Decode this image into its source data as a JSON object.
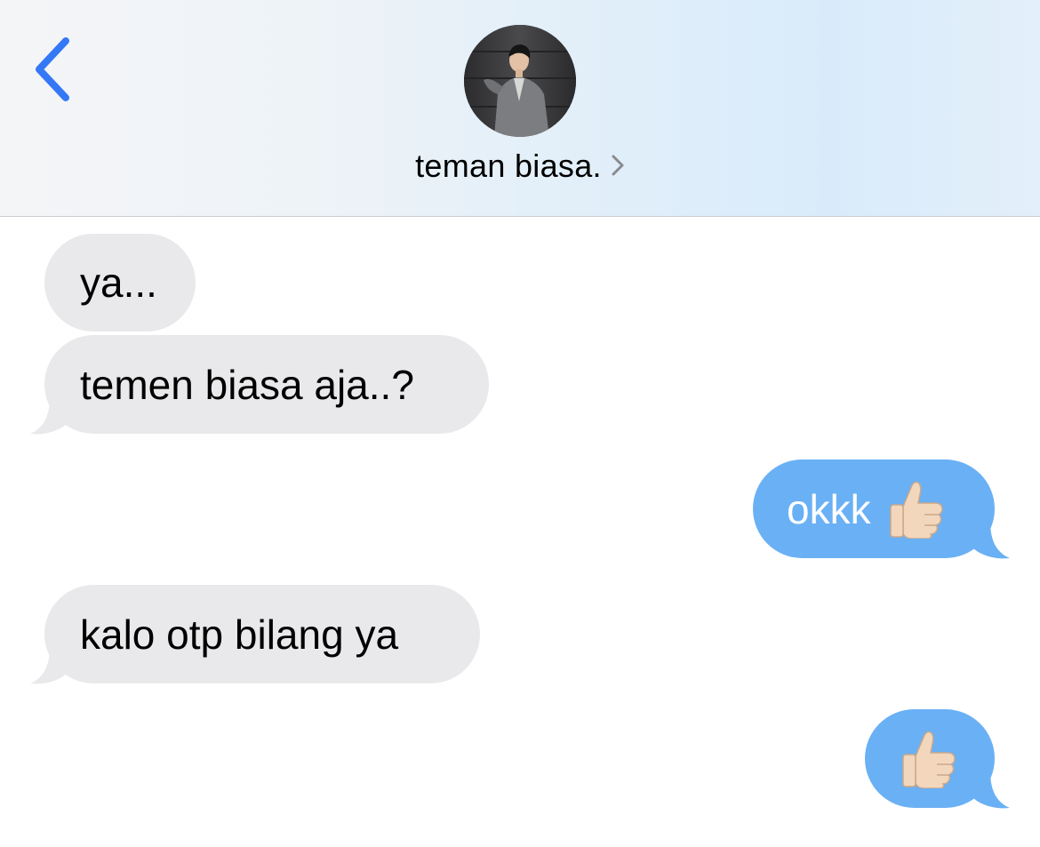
{
  "header": {
    "contact_name": "teman biasa.",
    "back_icon": "chevron-left-icon",
    "disclosure_icon": "chevron-right-icon"
  },
  "colors": {
    "accent": "#3478f6",
    "sent_bubble": "#6ab0f5",
    "received_bubble": "#e9e9eb"
  },
  "messages": [
    {
      "direction": "received",
      "text": "ya..."
    },
    {
      "direction": "received",
      "text": "temen biasa aja..?"
    },
    {
      "direction": "sent",
      "text": "okkk",
      "emoji": "thumbs-up-icon"
    },
    {
      "direction": "received",
      "text": "kalo otp bilang ya"
    },
    {
      "direction": "sent",
      "text": "",
      "emoji": "thumbs-up-icon"
    }
  ]
}
